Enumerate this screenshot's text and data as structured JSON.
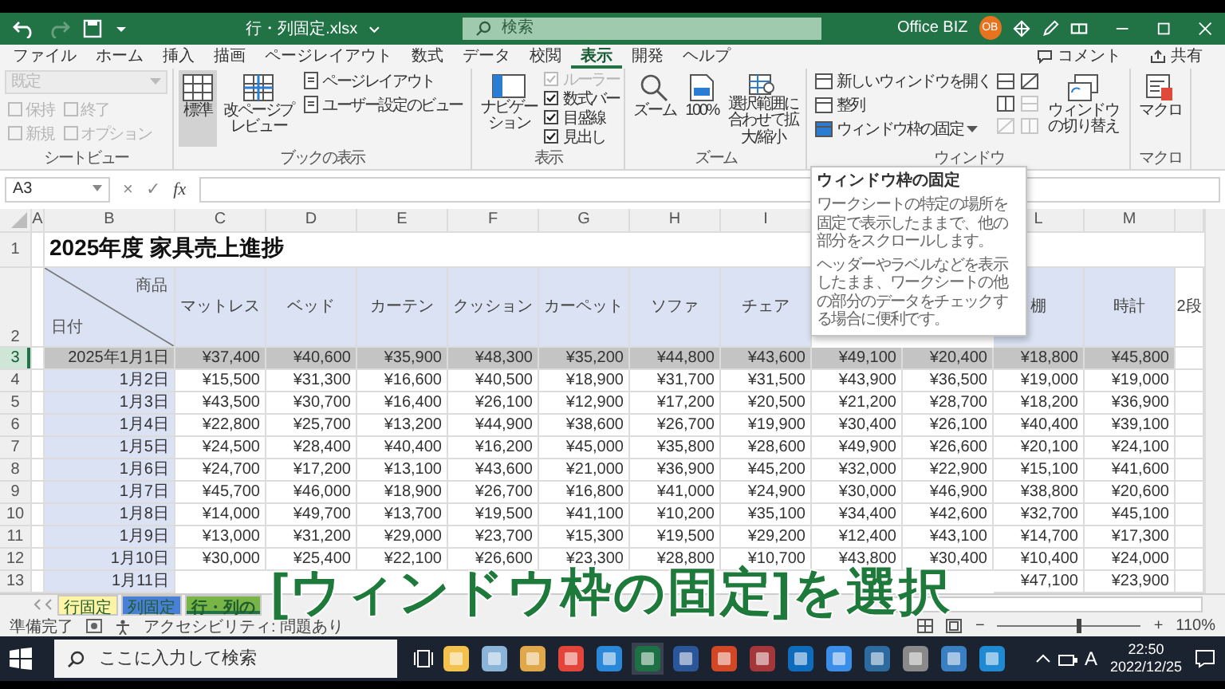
{
  "title_bar": {
    "file_name": "行・列固定.xlsx",
    "search": {
      "placeholder": "検索"
    },
    "account": "Office BIZ",
    "avatar": "OB"
  },
  "menu_tabs": [
    {
      "label": "ファイル",
      "selected": false
    },
    {
      "label": "ホーム",
      "selected": false
    },
    {
      "label": "挿入",
      "selected": false
    },
    {
      "label": "描画",
      "selected": false
    },
    {
      "label": "ページレイアウト",
      "selected": false
    },
    {
      "label": "数式",
      "selected": false
    },
    {
      "label": "データ",
      "selected": false
    },
    {
      "label": "校閲",
      "selected": false
    },
    {
      "label": "表示",
      "selected": true
    },
    {
      "label": "開発",
      "selected": false
    },
    {
      "label": "ヘルプ",
      "selected": false
    }
  ],
  "ribbon_right": {
    "comment": "コメント",
    "share": "共有"
  },
  "ribbon": {
    "sheet_view": {
      "dropdown": "既定",
      "buttons": [
        {
          "label": "保持",
          "disabled": true
        },
        {
          "label": "終了",
          "disabled": true
        },
        {
          "label": "新規",
          "disabled": true
        },
        {
          "label": "オプション",
          "disabled": true
        }
      ],
      "label": "シートビュー"
    },
    "book_view": {
      "buttons": [
        {
          "label": "標準",
          "selected": true
        },
        {
          "label": "改ページプレビュー",
          "selected": false
        }
      ],
      "small": [
        "ページレイアウト",
        "ユーザー設定のビュー"
      ],
      "label": "ブックの表示"
    },
    "show": {
      "navigation": "ナビゲーション",
      "checks": [
        {
          "label": "ルーラー",
          "checked": true,
          "disabled": true
        },
        {
          "label": "数式バー",
          "checked": true,
          "disabled": false
        },
        {
          "label": "目盛線",
          "checked": true,
          "disabled": false
        },
        {
          "label": "見出し",
          "checked": true,
          "disabled": false
        }
      ],
      "label": "表示"
    },
    "zoom": {
      "zoom": "ズーム",
      "hundred": "100%",
      "fit": "選択範囲に合わせて拡大/縮小",
      "label": "ズーム"
    },
    "window": {
      "small": [
        "新しいウィンドウを開く",
        "整列",
        "ウィンドウ枠の固定"
      ],
      "switch": "ウィンドウの切り替え",
      "label": "ウィンドウ"
    },
    "macro": {
      "button": "マクロ",
      "label": "マクロ"
    }
  },
  "formula_bar": {
    "name_box": "A3",
    "cancel": "×",
    "enter": "✓",
    "function": "fx"
  },
  "tooltip": {
    "title": "ウィンドウ枠の固定",
    "paragraphs": [
      "ワークシートの特定の場所を固定で表示したままで、他の部分をスクロールします。",
      "ヘッダーやラベルなどを表示したまま、ワークシートの他の部分のデータをチェックする場合に便利です。"
    ]
  },
  "sheet": {
    "column_letters": [
      "A",
      "B",
      "C",
      "D",
      "E",
      "F",
      "G",
      "H",
      "I"
    ],
    "column_letters_right": [
      "L",
      "M"
    ],
    "title_row": "1",
    "header_row": "2",
    "title": "2025年度 家具売上進捗",
    "corner": {
      "top": "商品",
      "bottom": "日付"
    },
    "products": [
      "マットレス",
      "ベッド",
      "カーテン",
      "クッション",
      "カーペット",
      "ソファ",
      "チェア"
    ],
    "products_right": [
      "棚",
      "時計",
      "2段"
    ],
    "rows": [
      {
        "number": "3",
        "date": "2025年1月1日",
        "selected": true,
        "values": [
          "¥37,400",
          "¥40,600",
          "¥35,900",
          "¥48,300",
          "¥35,200",
          "¥44,800",
          "¥43,600",
          "¥49,100",
          "¥20,400",
          "¥18,800",
          "¥45,800"
        ]
      },
      {
        "number": "4",
        "date": "1月2日",
        "selected": false,
        "values": [
          "¥15,500",
          "¥31,300",
          "¥16,600",
          "¥40,500",
          "¥18,900",
          "¥31,700",
          "¥31,500",
          "¥43,900",
          "¥36,500",
          "¥19,000",
          "¥19,000"
        ]
      },
      {
        "number": "5",
        "date": "1月3日",
        "selected": false,
        "values": [
          "¥43,500",
          "¥30,700",
          "¥16,400",
          "¥26,100",
          "¥12,900",
          "¥17,200",
          "¥20,500",
          "¥21,200",
          "¥28,700",
          "¥18,200",
          "¥36,900"
        ]
      },
      {
        "number": "6",
        "date": "1月4日",
        "selected": false,
        "values": [
          "¥22,800",
          "¥25,700",
          "¥13,200",
          "¥44,900",
          "¥38,600",
          "¥26,700",
          "¥19,900",
          "¥30,400",
          "¥26,100",
          "¥40,400",
          "¥39,100"
        ]
      },
      {
        "number": "7",
        "date": "1月5日",
        "selected": false,
        "values": [
          "¥24,500",
          "¥28,400",
          "¥40,400",
          "¥16,200",
          "¥45,000",
          "¥35,800",
          "¥28,600",
          "¥49,900",
          "¥26,600",
          "¥20,100",
          "¥24,100"
        ]
      },
      {
        "number": "8",
        "date": "1月6日",
        "selected": false,
        "values": [
          "¥24,700",
          "¥17,200",
          "¥13,100",
          "¥43,600",
          "¥21,000",
          "¥36,900",
          "¥45,200",
          "¥32,000",
          "¥22,900",
          "¥15,100",
          "¥41,600"
        ]
      },
      {
        "number": "9",
        "date": "1月7日",
        "selected": false,
        "values": [
          "¥45,700",
          "¥46,000",
          "¥18,900",
          "¥26,700",
          "¥16,800",
          "¥41,000",
          "¥24,900",
          "¥30,000",
          "¥46,900",
          "¥38,800",
          "¥20,600"
        ]
      },
      {
        "number": "10",
        "date": "1月8日",
        "selected": false,
        "values": [
          "¥14,000",
          "¥49,700",
          "¥13,700",
          "¥19,500",
          "¥41,100",
          "¥10,200",
          "¥35,100",
          "¥34,400",
          "¥42,600",
          "¥32,700",
          "¥45,100"
        ]
      },
      {
        "number": "11",
        "date": "1月9日",
        "selected": false,
        "values": [
          "¥13,000",
          "¥31,200",
          "¥29,000",
          "¥23,700",
          "¥15,300",
          "¥19,500",
          "¥29,200",
          "¥12,400",
          "¥43,100",
          "¥14,700",
          "¥17,300"
        ]
      },
      {
        "number": "12",
        "date": "1月10日",
        "selected": false,
        "values": [
          "¥30,000",
          "¥25,400",
          "¥22,100",
          "¥26,600",
          "¥23,300",
          "¥28,800",
          "¥10,700",
          "¥43,800",
          "¥30,400",
          "¥10,400",
          "¥24,000"
        ]
      },
      {
        "number": "13",
        "date": "1月11日",
        "selected": false,
        "values": [
          "¥47,100",
          "¥23,900"
        ]
      }
    ]
  },
  "sheet_tabs": [
    {
      "label": "行固定",
      "color": "#fff3a6",
      "selected": false
    },
    {
      "label": "列固定",
      "color": "#4a7fd6",
      "selected": false
    },
    {
      "label": "行・列の",
      "color": "#79b546",
      "selected": true
    }
  ],
  "status_bar": {
    "ready": "準備完了",
    "accessibility": "アクセシビリティ: 問題あり",
    "zoom_out": "−",
    "zoom_in": "+",
    "zoom_slider": {
      "level": 0.55
    },
    "zoom_level": "110%"
  },
  "taskbar": {
    "search": {
      "placeholder": "ここに入力して検索"
    },
    "ime": "A",
    "time": "22:50",
    "date": "2022/12/25"
  },
  "caption": "[ウィンドウ枠の固定]を選択"
}
